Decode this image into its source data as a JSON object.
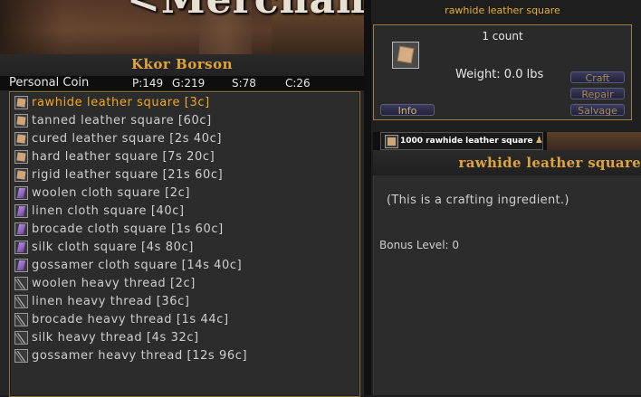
{
  "scene": {
    "title": "<Merchant>"
  },
  "merchant": {
    "name": "Kkor Borson",
    "coin_label": "Personal Coin",
    "coin": {
      "p": "P:149",
      "g": "G:219",
      "s": "S:78",
      "c": "C:26"
    }
  },
  "items": [
    {
      "label": "rawhide leather square [3c]",
      "icon": "leather-square-icon",
      "selected": true
    },
    {
      "label": "tanned leather square [60c]",
      "icon": "leather-square-icon"
    },
    {
      "label": "cured leather square [2s 40c]",
      "icon": "leather-square-icon"
    },
    {
      "label": "hard leather square [7s 20c]",
      "icon": "leather-square-icon"
    },
    {
      "label": "rigid leather square [21s 60c]",
      "icon": "leather-square-icon"
    },
    {
      "label": "woolen cloth square [2c]",
      "icon": "cloth-square-icon"
    },
    {
      "label": "linen cloth square [40c]",
      "icon": "cloth-square-icon"
    },
    {
      "label": "brocade cloth square [1s 60c]",
      "icon": "cloth-square-icon"
    },
    {
      "label": "silk cloth square [4s 80c]",
      "icon": "cloth-square-icon"
    },
    {
      "label": "gossamer cloth square [14s 40c]",
      "icon": "cloth-square-icon"
    },
    {
      "label": "woolen heavy thread [2c]",
      "icon": "thread-icon"
    },
    {
      "label": "linen heavy thread [36c]",
      "icon": "thread-icon"
    },
    {
      "label": "brocade heavy thread [1s 44c]",
      "icon": "thread-icon"
    },
    {
      "label": "silk heavy thread [4s 32c]",
      "icon": "thread-icon"
    },
    {
      "label": "gossamer heavy thread [12s 96c]",
      "icon": "thread-icon"
    }
  ],
  "detail": {
    "title": "rawhide leather square",
    "count": "1 count",
    "weight": "Weight: 0.0 lbs",
    "buttons": {
      "info": "Info",
      "craft": "Craft",
      "repair": "Repair",
      "salvage": "Salvage"
    }
  },
  "stack": {
    "label": "1000 rawhide leather square"
  },
  "description": {
    "title": "rawhide leather square",
    "text": "(This is a crafting ingredient.)",
    "bonus": "Bonus Level: 0"
  },
  "colors": {
    "accent": "#e0a43a",
    "selected_text": "#f2a81f",
    "list_border": "#8a7240"
  }
}
